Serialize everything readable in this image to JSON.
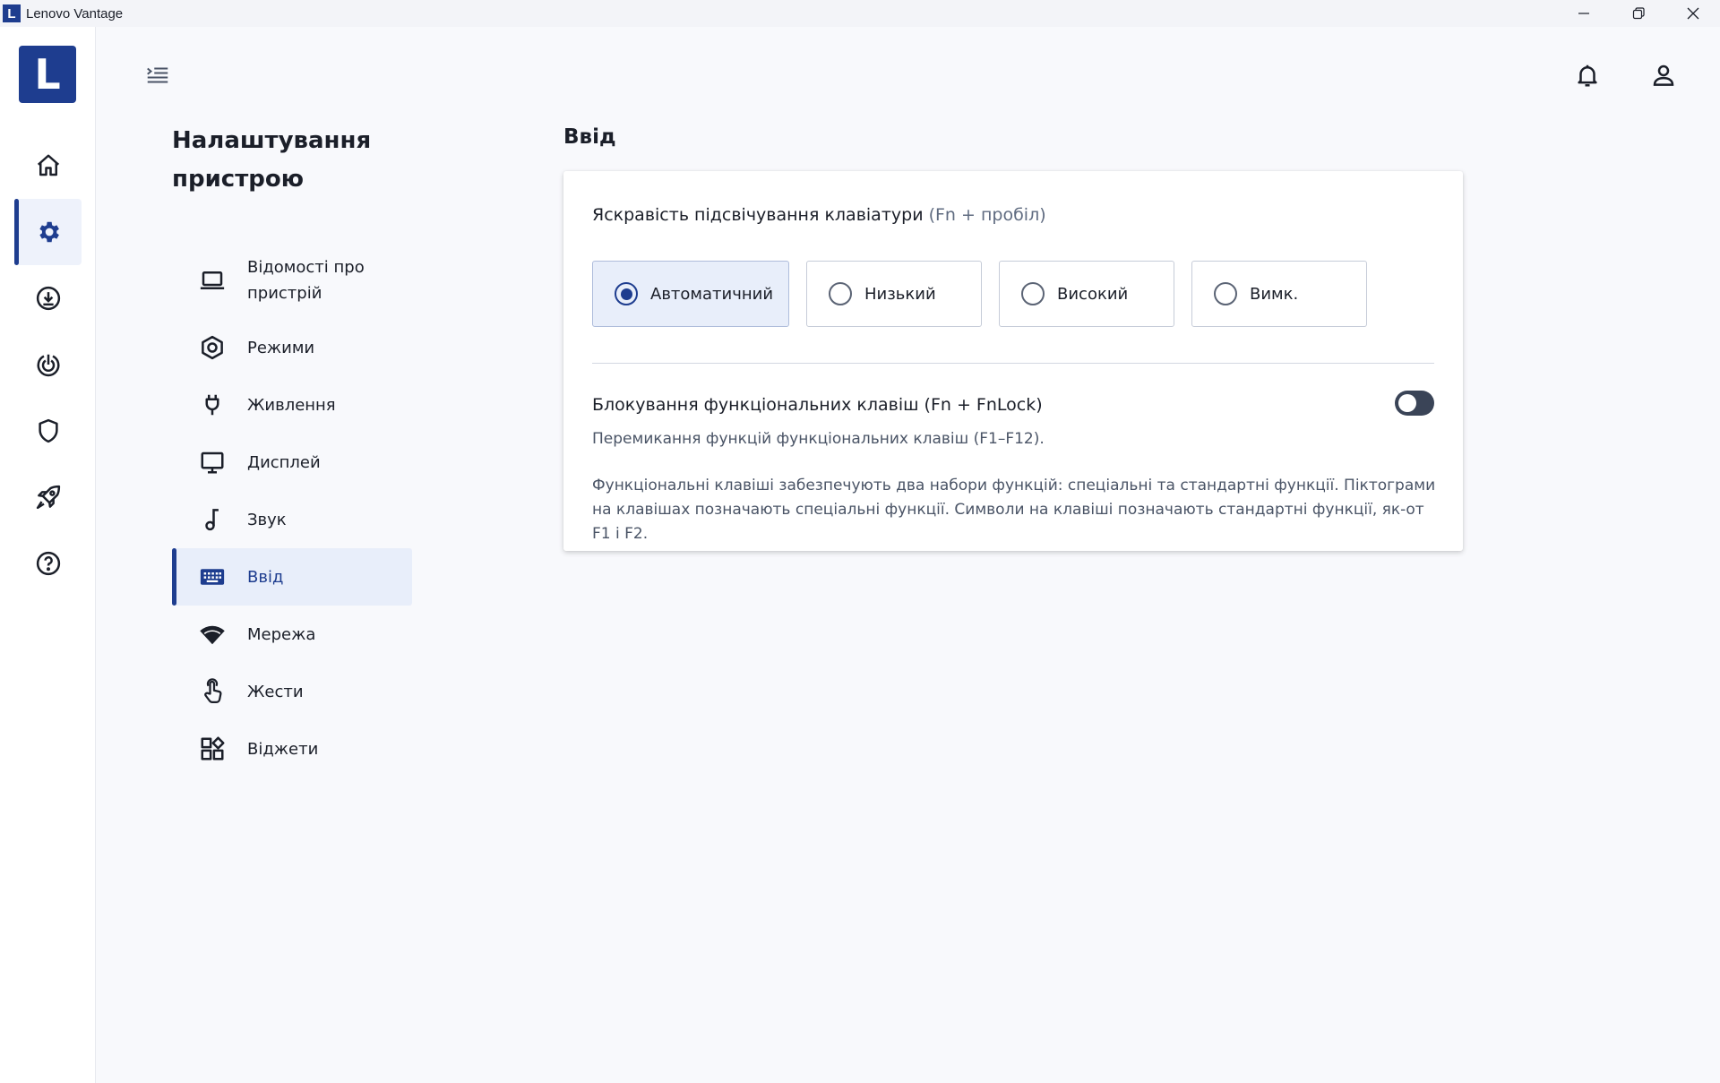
{
  "window": {
    "app_icon_letter": "L",
    "title": "Lenovo Vantage",
    "controls": [
      "minimize-icon",
      "restore-icon",
      "close-icon"
    ]
  },
  "rail": {
    "logo_letter": "L",
    "items": [
      {
        "icon": "home-icon",
        "active": false
      },
      {
        "icon": "gear-icon",
        "active": true
      },
      {
        "icon": "download-icon",
        "active": false
      },
      {
        "icon": "power-target-icon",
        "active": false
      },
      {
        "icon": "shield-icon",
        "active": false
      },
      {
        "icon": "rocket-icon",
        "active": false
      },
      {
        "icon": "help-icon",
        "active": false
      }
    ]
  },
  "header": {
    "menu_icon": "menu-collapse-icon",
    "notifications_icon": "bell-icon",
    "account_icon": "user-icon"
  },
  "nav": {
    "title": "Налаштування пристрою",
    "items": [
      {
        "label": "Відомості про пристрій",
        "icon": "laptop-icon"
      },
      {
        "label": "Режими",
        "icon": "hexagon-icon"
      },
      {
        "label": "Живлення",
        "icon": "plug-icon"
      },
      {
        "label": "Дисплей",
        "icon": "monitor-icon"
      },
      {
        "label": "Звук",
        "icon": "music-note-icon"
      },
      {
        "label": "Ввід",
        "icon": "keyboard-icon",
        "active": true
      },
      {
        "label": "Мережа",
        "icon": "wifi-icon"
      },
      {
        "label": "Жести",
        "icon": "touch-hand-icon"
      },
      {
        "label": "Віджети",
        "icon": "widgets-icon"
      }
    ]
  },
  "content": {
    "section_title": "Ввід",
    "backlight": {
      "title": "Яскравість підсвічування клавіатури",
      "hint": "(Fn + пробіл)",
      "options": [
        "Автоматичний",
        "Низький",
        "Високий",
        "Вимк."
      ],
      "selected": "Автоматичний"
    },
    "fnlock": {
      "title": "Блокування функціональних клавіш (Fn + FnLock)",
      "subtitle": "Перемикання функцій функціональних клавіш (F1–F12).",
      "description": "Функціональні клавіші забезпечують два набори функцій: спеціальні та стандартні функції. Піктограми на клавішах позначають спеціальні функції. Символи на клавіші позначають стандартні функції, як-от F1 і F2.",
      "enabled": false
    }
  },
  "colors": {
    "brand": "#1e3d8f",
    "active_bg": "#e8eefa",
    "toggle_off": "#3a4457"
  }
}
